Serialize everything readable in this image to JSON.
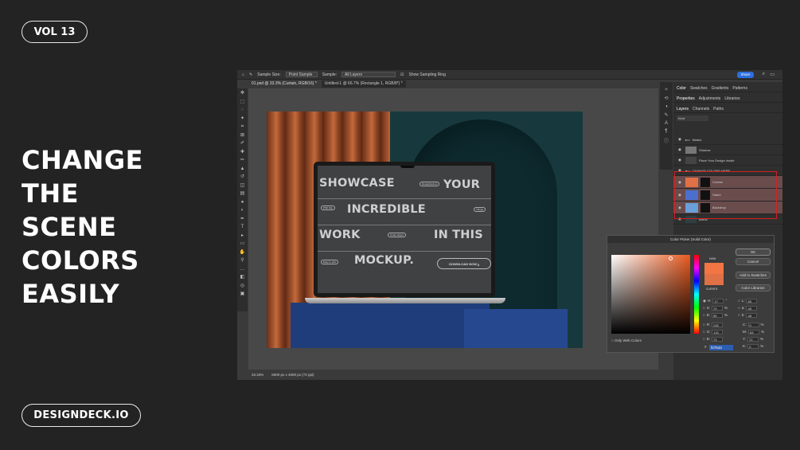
{
  "promo": {
    "volume": "VOL 13",
    "headline_lines": [
      "CHANGE",
      "THE",
      "SCENE",
      "COLORS",
      "EASILY"
    ],
    "brand": "DESIGNDECK.IO"
  },
  "photoshop": {
    "options_bar": {
      "sample_size_label": "Sample Size:",
      "sample_size_value": "Point Sample",
      "sample_label": "Sample:",
      "sample_value": "All Layers",
      "show_ring": "Show Sampling Ring",
      "share": "Share"
    },
    "tabs": [
      "01.psd @ 33.3% (Curtain, RGB/16) *",
      "Untitled-1 @ 66.7% (Rectangle 1, RGB/8*) *"
    ],
    "status": {
      "zoom": "33.33%",
      "doc_size": "6000 px x 4500 px (72 ppi)"
    },
    "panel_tabs_top": [
      "Color",
      "Swatches",
      "Gradients",
      "Patterns"
    ],
    "panel_tabs_mid": [
      "Properties",
      "Adjustments",
      "Libraries"
    ],
    "panel_tabs_layers": [
      "Layers",
      "Channels",
      "Paths"
    ],
    "layers_search": "Kind",
    "layers": [
      {
        "name": "Masks",
        "selected": false
      },
      {
        "name": "Shadow",
        "selected": false
      },
      {
        "name": "Place Your Design Inside",
        "selected": false
      },
      {
        "name": "CHANGE COLORS HERE",
        "selected": false
      },
      {
        "name": "Curtain",
        "selected": true
      },
      {
        "name": "Stand",
        "selected": true
      },
      {
        "name": "Backdrop",
        "selected": true
      },
      {
        "name": "scene",
        "selected": false
      }
    ],
    "mockup_screen": {
      "words": [
        "SHOWCASE",
        "YOUR",
        "INCREDIBLE",
        "WORK",
        "IN THIS",
        "MOCKUP."
      ],
      "tags": [
        "DesignDeck.io",
        "PSD File",
        "Things",
        "Smart object",
        "Easy to edit"
      ],
      "button": "DOWNLOAD NOW"
    },
    "color_picker": {
      "title": "Color Picker (Solid Color)",
      "new_label": "new",
      "current_label": "current",
      "buttons": [
        "OK",
        "Cancel",
        "Add to Swatches",
        "Color Libraries"
      ],
      "only_web": "Only Web Colors",
      "hsb": {
        "H": "17",
        "S": "70",
        "B": "95"
      },
      "rgb": {
        "R": "242",
        "G": "121",
        "B": "73"
      },
      "lab": {
        "L": "65",
        "a": "45",
        "b": "48"
      },
      "cmyk": {
        "C": "0",
        "M": "63",
        "Y": "72",
        "K": "0"
      },
      "hex": "f27543",
      "new_color": "#f27543",
      "current_color": "#e07046"
    }
  }
}
